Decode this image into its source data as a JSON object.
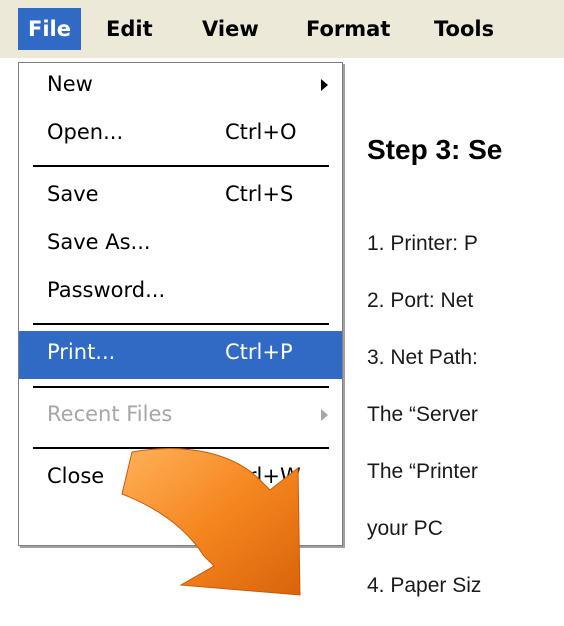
{
  "menubar": {
    "items": [
      "File",
      "Edit",
      "View",
      "Format",
      "Tools"
    ],
    "active_index": 0
  },
  "file_menu": {
    "items": [
      {
        "label": "New",
        "shortcut": "",
        "submenu": true,
        "state": "normal"
      },
      {
        "label": "Open...",
        "shortcut": "Ctrl+O",
        "submenu": false,
        "state": "normal"
      },
      {
        "label": "Save",
        "shortcut": "Ctrl+S",
        "submenu": false,
        "state": "normal"
      },
      {
        "label": "Save As...",
        "shortcut": "",
        "submenu": false,
        "state": "normal"
      },
      {
        "label": "Password...",
        "shortcut": "",
        "submenu": false,
        "state": "normal"
      },
      {
        "label": "Print...",
        "shortcut": "Ctrl+P",
        "submenu": false,
        "state": "highlighted"
      },
      {
        "label": "Recent Files",
        "shortcut": "",
        "submenu": true,
        "state": "disabled"
      },
      {
        "label": "Close",
        "shortcut": "Ctrl+W",
        "submenu": false,
        "state": "normal"
      }
    ]
  },
  "document": {
    "heading": "Step 3: Se",
    "lines": [
      "1. Printer: P",
      "2. Port: Net",
      "3. Net Path:",
      "The “Server",
      "The “Printer",
      "your PC",
      "4. Paper Siz"
    ]
  },
  "colors": {
    "menubar_bg": "#ece9d8",
    "highlight": "#316ac5",
    "disabled_text": "#a6a6a6",
    "arrow_orange": "#f07a1a"
  },
  "icons": {
    "submenu": "triangle-right-icon",
    "callout_arrow": "curved-arrow-icon"
  }
}
